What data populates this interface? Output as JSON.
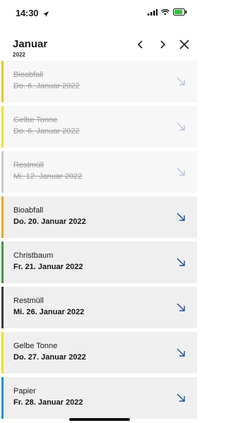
{
  "status_bar": {
    "time": "14:30",
    "icons": [
      "location-arrow-icon",
      "signal-icon",
      "wifi-icon",
      "battery-icon"
    ]
  },
  "header": {
    "month": "Januar",
    "year": "2022",
    "prev_icon": "chevron-left-icon",
    "next_icon": "chevron-right-icon",
    "close_icon": "close-icon"
  },
  "events": [
    {
      "name": "Bioabfall",
      "date": "Do. 6. Januar 2022",
      "status": "past",
      "color": "#f2c12e"
    },
    {
      "name": "Gelbe Tonne",
      "date": "Do. 6. Januar 2022",
      "status": "past",
      "color": "#f2dc3a"
    },
    {
      "name": "Restmüll",
      "date": "Mi. 12. Januar 2022",
      "status": "past",
      "color": "#c9c9c9"
    },
    {
      "name": "Bioabfall",
      "date": "Do. 20. Januar 2022",
      "status": "upcoming",
      "color": "#f0a21a"
    },
    {
      "name": "Christbaum",
      "date": "Fr. 21. Januar 2022",
      "status": "upcoming",
      "color": "#3c9a3a"
    },
    {
      "name": "Restmüll",
      "date": "Mi. 26. Januar 2022",
      "status": "upcoming",
      "color": "#3b3b3b"
    },
    {
      "name": "Gelbe Tonne",
      "date": "Do. 27. Januar 2022",
      "status": "upcoming",
      "color": "#f2dd2a"
    },
    {
      "name": "Papier",
      "date": "Fr. 28. Januar 2022",
      "status": "upcoming",
      "color": "#1f8fd6"
    }
  ],
  "colors": {
    "arrow_active": "#1d4ea2",
    "arrow_past": "#b8c6dd"
  }
}
